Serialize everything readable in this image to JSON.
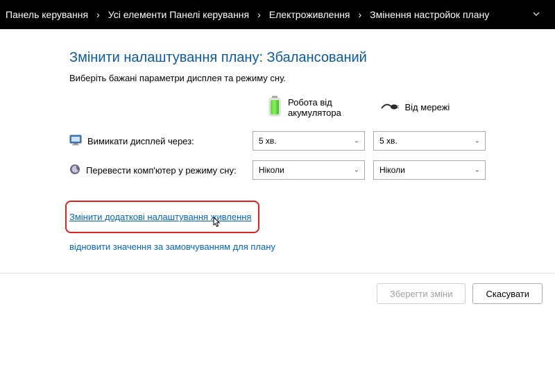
{
  "breadcrumb": {
    "items": [
      "Панель керування",
      "Усі елементи Панелі керування",
      "Електроживлення",
      "Змінення настройок плану"
    ]
  },
  "title": "Змінити налаштування плану: Збалансований",
  "description": "Виберіть бажані параметри дисплея та режиму сну.",
  "columns": {
    "battery": "Робота від акумулятора",
    "plugged": "Від мережі"
  },
  "rows": {
    "display": {
      "label": "Вимикати дисплей через:",
      "battery_value": "5 хв.",
      "plugged_value": "5 хв."
    },
    "sleep": {
      "label": "Перевести комп'ютер у режиму сну:",
      "battery_value": "Ніколи",
      "plugged_value": "Ніколи"
    }
  },
  "links": {
    "advanced": "Змінити додаткові налаштування живлення",
    "restore": "відновити значення за замовчуванням для плану"
  },
  "buttons": {
    "save": "Зберегти зміни",
    "cancel": "Скасувати"
  }
}
